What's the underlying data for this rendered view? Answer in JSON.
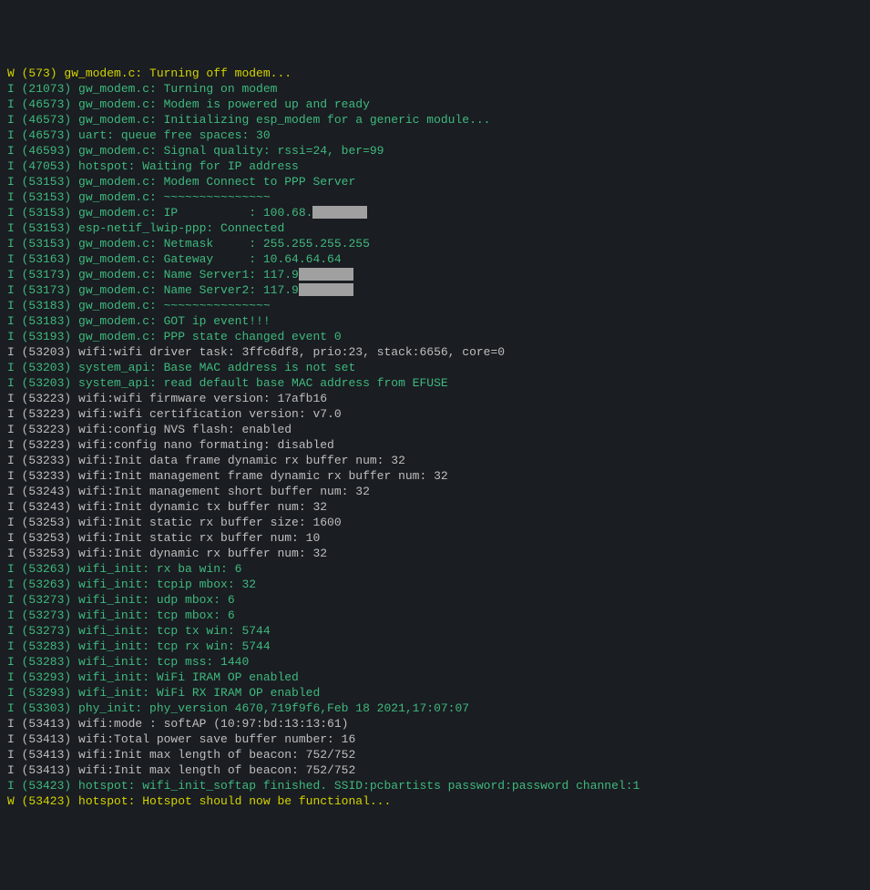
{
  "lines": [
    {
      "level": "W",
      "ts": "573",
      "tag": "gw_modem.c",
      "msg": "Turning off modem...",
      "color": "warn"
    },
    {
      "level": "I",
      "ts": "21073",
      "tag": "gw_modem.c",
      "msg": "Turning on modem",
      "color": "green"
    },
    {
      "level": "I",
      "ts": "46573",
      "tag": "gw_modem.c",
      "msg": "Modem is powered up and ready",
      "color": "green"
    },
    {
      "level": "I",
      "ts": "46573",
      "tag": "gw_modem.c",
      "msg": "Initializing esp_modem for a generic module...",
      "color": "green"
    },
    {
      "level": "I",
      "ts": "46573",
      "tag": "uart",
      "msg": "queue free spaces: 30",
      "color": "green"
    },
    {
      "level": "I",
      "ts": "46593",
      "tag": "gw_modem.c",
      "msg": "Signal quality: rssi=24, ber=99",
      "color": "green"
    },
    {
      "level": "I",
      "ts": "47053",
      "tag": "hotspot",
      "msg": "Waiting for IP address",
      "color": "green"
    },
    {
      "level": "I",
      "ts": "53153",
      "tag": "gw_modem.c",
      "msg": "Modem Connect to PPP Server",
      "color": "green"
    },
    {
      "level": "I",
      "ts": "53153",
      "tag": "gw_modem.c",
      "msg": "~~~~~~~~~~~~~~~",
      "color": "green"
    },
    {
      "level": "I",
      "ts": "53153",
      "tag": "gw_modem.c",
      "msg": "IP          : 100.68.",
      "color": "green",
      "redact": 1
    },
    {
      "level": "I",
      "ts": "53153",
      "tag": "esp-netif_lwip-ppp",
      "msg": "Connected",
      "color": "green"
    },
    {
      "level": "I",
      "ts": "53153",
      "tag": "gw_modem.c",
      "msg": "Netmask     : 255.255.255.255",
      "color": "green"
    },
    {
      "level": "I",
      "ts": "53163",
      "tag": "gw_modem.c",
      "msg": "Gateway     : 10.64.64.64",
      "color": "green"
    },
    {
      "level": "I",
      "ts": "53173",
      "tag": "gw_modem.c",
      "msg": "Name Server1: 117.9",
      "color": "green",
      "redact": 2
    },
    {
      "level": "I",
      "ts": "53173",
      "tag": "gw_modem.c",
      "msg": "Name Server2: 117.9",
      "color": "green",
      "redact": 2
    },
    {
      "level": "I",
      "ts": "53183",
      "tag": "gw_modem.c",
      "msg": "~~~~~~~~~~~~~~~",
      "color": "green"
    },
    {
      "level": "I",
      "ts": "53183",
      "tag": "gw_modem.c",
      "msg": "GOT ip event!!!",
      "color": "green"
    },
    {
      "level": "I",
      "ts": "53193",
      "tag": "gw_modem.c",
      "msg": "PPP state changed event 0",
      "color": "green"
    },
    {
      "level": "I",
      "ts": "53203",
      "tag": "wifi",
      "msg": "wifi driver task: 3ffc6df8, prio:23, stack:6656, core=0",
      "color": "gray",
      "sep": ":"
    },
    {
      "level": "I",
      "ts": "53203",
      "tag": "system_api",
      "msg": "Base MAC address is not set",
      "color": "green"
    },
    {
      "level": "I",
      "ts": "53203",
      "tag": "system_api",
      "msg": "read default base MAC address from EFUSE",
      "color": "green"
    },
    {
      "level": "I",
      "ts": "53223",
      "tag": "wifi",
      "msg": "wifi firmware version: 17afb16",
      "color": "gray",
      "sep": ":"
    },
    {
      "level": "I",
      "ts": "53223",
      "tag": "wifi",
      "msg": "wifi certification version: v7.0",
      "color": "gray",
      "sep": ":"
    },
    {
      "level": "I",
      "ts": "53223",
      "tag": "wifi",
      "msg": "config NVS flash: enabled",
      "color": "gray",
      "sep": ":"
    },
    {
      "level": "I",
      "ts": "53223",
      "tag": "wifi",
      "msg": "config nano formating: disabled",
      "color": "gray",
      "sep": ":"
    },
    {
      "level": "I",
      "ts": "53233",
      "tag": "wifi",
      "msg": "Init data frame dynamic rx buffer num: 32",
      "color": "gray",
      "sep": ":"
    },
    {
      "level": "I",
      "ts": "53233",
      "tag": "wifi",
      "msg": "Init management frame dynamic rx buffer num: 32",
      "color": "gray",
      "sep": ":"
    },
    {
      "level": "I",
      "ts": "53243",
      "tag": "wifi",
      "msg": "Init management short buffer num: 32",
      "color": "gray",
      "sep": ":"
    },
    {
      "level": "I",
      "ts": "53243",
      "tag": "wifi",
      "msg": "Init dynamic tx buffer num: 32",
      "color": "gray",
      "sep": ":"
    },
    {
      "level": "I",
      "ts": "53253",
      "tag": "wifi",
      "msg": "Init static rx buffer size: 1600",
      "color": "gray",
      "sep": ":"
    },
    {
      "level": "I",
      "ts": "53253",
      "tag": "wifi",
      "msg": "Init static rx buffer num: 10",
      "color": "gray",
      "sep": ":"
    },
    {
      "level": "I",
      "ts": "53253",
      "tag": "wifi",
      "msg": "Init dynamic rx buffer num: 32",
      "color": "gray",
      "sep": ":"
    },
    {
      "level": "I",
      "ts": "53263",
      "tag": "wifi_init",
      "msg": "rx ba win: 6",
      "color": "green"
    },
    {
      "level": "I",
      "ts": "53263",
      "tag": "wifi_init",
      "msg": "tcpip mbox: 32",
      "color": "green"
    },
    {
      "level": "I",
      "ts": "53273",
      "tag": "wifi_init",
      "msg": "udp mbox: 6",
      "color": "green"
    },
    {
      "level": "I",
      "ts": "53273",
      "tag": "wifi_init",
      "msg": "tcp mbox: 6",
      "color": "green"
    },
    {
      "level": "I",
      "ts": "53273",
      "tag": "wifi_init",
      "msg": "tcp tx win: 5744",
      "color": "green"
    },
    {
      "level": "I",
      "ts": "53283",
      "tag": "wifi_init",
      "msg": "tcp rx win: 5744",
      "color": "green"
    },
    {
      "level": "I",
      "ts": "53283",
      "tag": "wifi_init",
      "msg": "tcp mss: 1440",
      "color": "green"
    },
    {
      "level": "I",
      "ts": "53293",
      "tag": "wifi_init",
      "msg": "WiFi IRAM OP enabled",
      "color": "green"
    },
    {
      "level": "I",
      "ts": "53293",
      "tag": "wifi_init",
      "msg": "WiFi RX IRAM OP enabled",
      "color": "green"
    },
    {
      "level": "I",
      "ts": "53303",
      "tag": "phy_init",
      "msg": "phy_version 4670,719f9f6,Feb 18 2021,17:07:07",
      "color": "green"
    },
    {
      "level": "I",
      "ts": "53413",
      "tag": "wifi",
      "msg": "mode : softAP (10:97:bd:13:13:61)",
      "color": "gray",
      "sep": ":"
    },
    {
      "level": "I",
      "ts": "53413",
      "tag": "wifi",
      "msg": "Total power save buffer number: 16",
      "color": "gray",
      "sep": ":"
    },
    {
      "level": "I",
      "ts": "53413",
      "tag": "wifi",
      "msg": "Init max length of beacon: 752/752",
      "color": "gray",
      "sep": ":"
    },
    {
      "level": "I",
      "ts": "53413",
      "tag": "wifi",
      "msg": "Init max length of beacon: 752/752",
      "color": "gray",
      "sep": ":"
    },
    {
      "level": "I",
      "ts": "53423",
      "tag": "hotspot",
      "msg": "wifi_init_softap finished. SSID:pcbartists password:password channel:1",
      "color": "green"
    },
    {
      "level": "W",
      "ts": "53423",
      "tag": "hotspot",
      "msg": "Hotspot should now be functional...",
      "color": "warn"
    }
  ]
}
